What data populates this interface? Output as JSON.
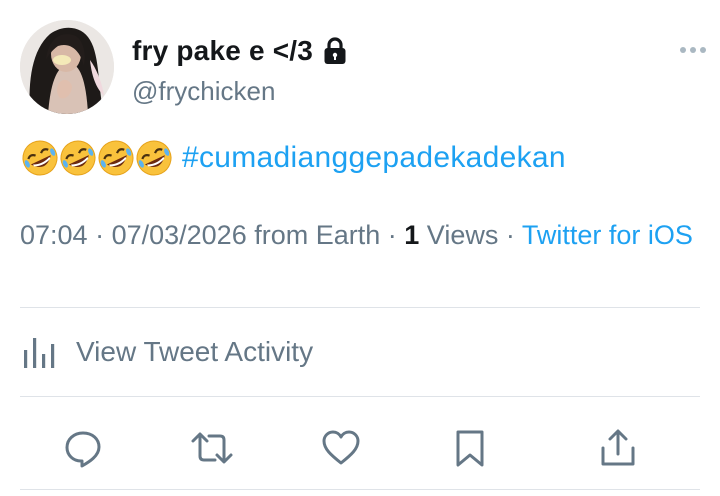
{
  "user": {
    "display_name": "fry pake e </3",
    "handle": "@frychicken",
    "protected_icon": "lock-icon",
    "avatar": "avatar"
  },
  "tweet": {
    "emojis": [
      "🤣",
      "🤣",
      "🤣",
      "🤣"
    ],
    "hashtag": "#cumadianggepadekadekan"
  },
  "meta": {
    "time": "07:04",
    "sep1": " · ",
    "date": "07/03/2026",
    "location": " from Earth",
    "sep2": " · ",
    "views_count": "1",
    "views_label": " Views",
    "sep3": " · ",
    "source": "Twitter for iOS"
  },
  "activity": {
    "label": "View Tweet Activity",
    "icon": "analytics-icon"
  },
  "actions": {
    "reply_icon": "reply-icon",
    "retweet_icon": "retweet-icon",
    "like_icon": "heart-icon",
    "bookmark_icon": "bookmark-icon",
    "share_icon": "share-icon"
  },
  "colors": {
    "accent": "#1da1f2",
    "text_primary": "#14171a",
    "text_secondary": "#657786",
    "divider": "#dfe3e8"
  }
}
